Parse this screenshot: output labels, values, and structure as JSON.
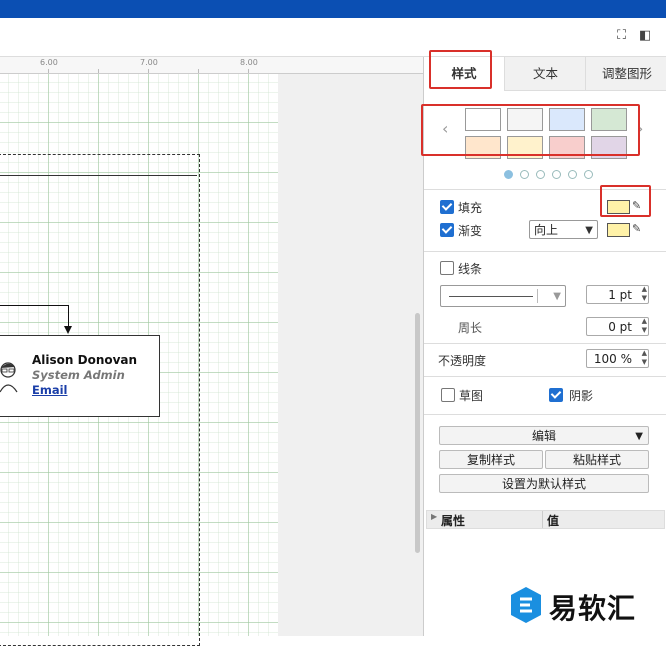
{
  "ruler": {
    "ticks": [
      "6.00",
      "7.00",
      "8.00"
    ]
  },
  "card": {
    "name": "Alison Donovan",
    "role": "System Admin",
    "email": "Email"
  },
  "panel": {
    "tabs": [
      {
        "label": "样式",
        "active": true
      },
      {
        "label": "文本",
        "active": false
      },
      {
        "label": "调整图形",
        "active": false
      }
    ],
    "swatches": [
      "#ffffff",
      "#f5f5f5",
      "#dae8fc",
      "#d5e8d4",
      "#ffe6cc",
      "#fff2cc",
      "#f8cecc",
      "#e1d5e7"
    ],
    "fill_label": "填充",
    "fill_checked": true,
    "fill_color": "#fff2a8",
    "gradient_label": "渐变",
    "gradient_checked": true,
    "gradient_direction": "向上",
    "gradient_color": "#fff2a8",
    "line_label": "线条",
    "line_checked": false,
    "line_width": "1 pt",
    "perimeter_label": "周长",
    "perimeter_value": "0 pt",
    "opacity_label": "不透明度",
    "opacity_value": "100 %",
    "sketch_label": "草图",
    "sketch_checked": false,
    "shadow_label": "阴影",
    "shadow_checked": true,
    "edit_label": "编辑",
    "copy_style": "复制样式",
    "paste_style": "粘贴样式",
    "set_default_style": "设置为默认样式",
    "props_col_name": "属性",
    "props_col_value": "值"
  },
  "watermark": {
    "text": "易软汇"
  },
  "colors": {
    "accent_red": "#d9302a",
    "topbar": "#0b4fb3",
    "check_blue": "#1f6fd1"
  }
}
